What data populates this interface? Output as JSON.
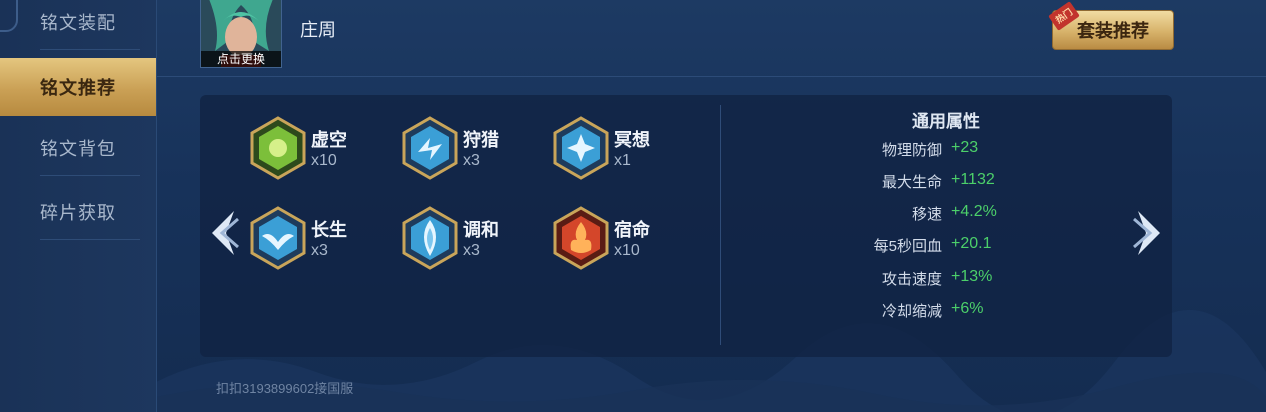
{
  "sidebar": {
    "items": [
      {
        "label": "铭文装配"
      },
      {
        "label": "铭文推荐"
      },
      {
        "label": "铭文背包"
      },
      {
        "label": "碎片获取"
      }
    ],
    "active_index": 1
  },
  "header": {
    "avatar_label": "点击更换",
    "hero_name": "庄周",
    "suite_button": "套装推荐",
    "hot_tag": "热门"
  },
  "runes": [
    {
      "name": "虚空",
      "count": "x10",
      "color": "#7cbf3a",
      "icon": "void-rune-icon"
    },
    {
      "name": "狩猎",
      "count": "x3",
      "color": "#3b9fd6",
      "icon": "hunt-rune-icon"
    },
    {
      "name": "冥想",
      "count": "x1",
      "color": "#3b9fd6",
      "icon": "meditation-rune-icon"
    },
    {
      "name": "长生",
      "count": "x3",
      "color": "#3b9fd6",
      "icon": "longevity-rune-icon"
    },
    {
      "name": "调和",
      "count": "x3",
      "color": "#3b9fd6",
      "icon": "harmony-rune-icon"
    },
    {
      "name": "宿命",
      "count": "x10",
      "color": "#d4462a",
      "icon": "destiny-rune-icon"
    }
  ],
  "attributes": {
    "title": "通用属性",
    "items": [
      {
        "name": "物理防御",
        "value": "+23"
      },
      {
        "name": "最大生命",
        "value": "+1132"
      },
      {
        "name": "移速",
        "value": "+4.2%"
      },
      {
        "name": "每5秒回血",
        "value": "+20.1"
      },
      {
        "name": "攻击速度",
        "value": "+13%"
      },
      {
        "name": "冷却缩减",
        "value": "+6%"
      }
    ]
  },
  "footer": {
    "text": "扣扣3193899602接国服"
  },
  "colors": {
    "accent_gold": "#d7b26a",
    "positive_green": "#4cd06a"
  }
}
